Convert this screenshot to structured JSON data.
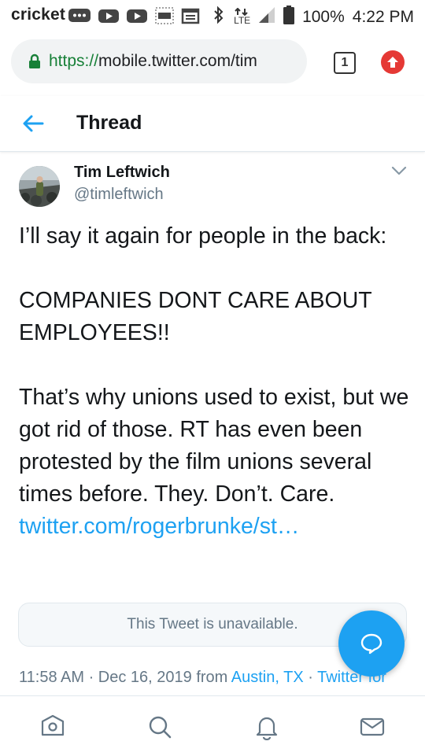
{
  "status_bar": {
    "carrier": "cricket",
    "signal_type": "LTE",
    "battery": "100%",
    "time": "4:22 PM"
  },
  "browser": {
    "url_scheme": "https://",
    "url_rest": "mobile.twitter.com/tim",
    "tab_count": "1"
  },
  "header": {
    "title": "Thread"
  },
  "tweet": {
    "author_name": "Tim Leftwich",
    "author_handle": "@timleftwich",
    "para1": "I’ll say it again for people in the back:",
    "para2": "COMPANIES DONT CARE ABOUT EMPLOYEES!!",
    "para3": "That’s why unions used to exist, but we got rid of those. RT has even been protested by the film unions several times before. They. Don’t. Care.",
    "link": "twitter.com/rogerbrunke/st…",
    "unavailable_text": "This Tweet is unavailable.",
    "timestamp": "11:58 AM · Dec 16, 2019 from ",
    "location": "Austin, TX",
    "separator": " · ",
    "source": "Twitter for iPhone"
  },
  "nav": {
    "items": [
      "home-icon",
      "search-icon",
      "notifications-icon",
      "messages-icon"
    ]
  },
  "colors": {
    "twitter_blue": "#1da1f2",
    "secure_green": "#188038",
    "update_red": "#e53935"
  }
}
